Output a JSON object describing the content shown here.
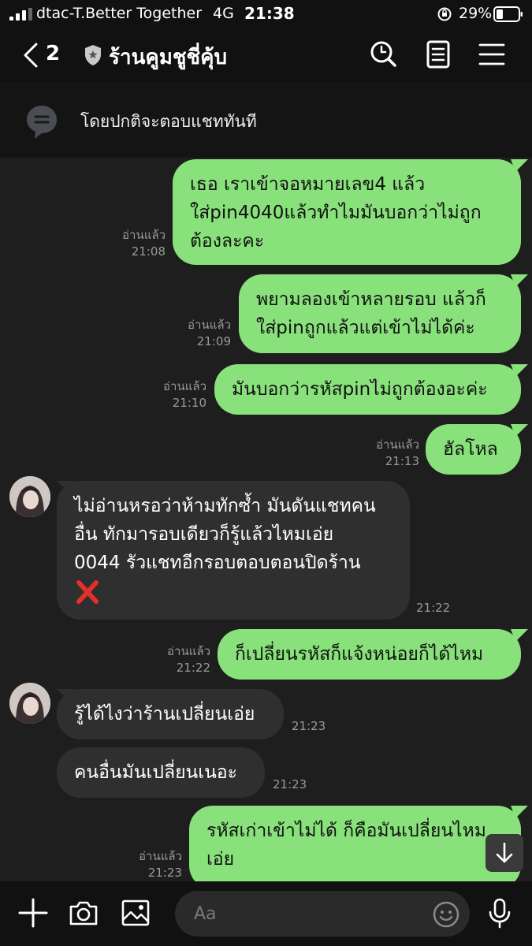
{
  "status_bar": {
    "carrier": "dtac-T.Better Together",
    "network": "4G",
    "time": "21:38",
    "battery": "29%"
  },
  "header": {
    "back_count": "2",
    "title": "ร้านคูมชูชี่คุ้บ",
    "icons": [
      "back-chevron-icon",
      "shield-star-icon",
      "search-icon",
      "note-icon",
      "menu-icon"
    ]
  },
  "notice": {
    "text": "โดยปกติจะตอบแชททันที",
    "icon": "chat-bubble-icon"
  },
  "messages": [
    {
      "direction": "out",
      "lines": [
        "เธอ เราเข้าจอหมายเลข4 แล้ว",
        "ใส่pin4040แล้วทำไมมันบอกว่าไม่ถูก",
        "ต้องละคะ"
      ],
      "read": "อ่านแล้ว",
      "time": "21:08"
    },
    {
      "direction": "out",
      "lines": [
        "พยามลองเข้าหลายรอบ แล้วก็",
        "ใส่pinถูกแล้วแต่เข้าไม่ได้ค่ะ"
      ],
      "read": "อ่านแล้ว",
      "time": "21:09"
    },
    {
      "direction": "out",
      "lines": [
        "มันบอกว่ารหัสpinไม่ถูกต้องอะค่ะ"
      ],
      "read": "อ่านแล้ว",
      "time": "21:10"
    },
    {
      "direction": "out",
      "lines": [
        "ฮัลโหล"
      ],
      "read": "อ่านแล้ว",
      "time": "21:13"
    },
    {
      "direction": "in",
      "lines": [
        "ไม่อ่านหรอว่าห้ามทักซ้ำ มันดันแชทคน",
        "อื่น ทักมารอบเดียวก็รู้แล้วไหมเอ่ย",
        "0044 รัวแชทอีกรอบตอบตอนปิดร้าน"
      ],
      "trailing_icon": "red-x-icon",
      "time": "21:22"
    },
    {
      "direction": "out",
      "lines": [
        "ก็เปลี่ยนรหัสก็แจ้งหน่อยก็ได้ไหม"
      ],
      "read": "อ่านแล้ว",
      "time": "21:22"
    },
    {
      "direction": "in",
      "lines": [
        "รู้ได้ไงว่าร้านเปลี่ยนเอ่ย"
      ],
      "time": "21:23"
    },
    {
      "direction": "in",
      "lines": [
        "คนอื่นมันเปลี่ยนเนอะ"
      ],
      "time": "21:23"
    },
    {
      "direction": "out",
      "lines": [
        "รหัสเก่าเข้าไม่ได้ ก็คือมันเปลี่ยนไหม",
        "เอ่ย"
      ],
      "read": "อ่านแล้ว",
      "time": "21:23"
    }
  ],
  "input_bar": {
    "placeholder": "Aa",
    "icons": [
      "plus-icon",
      "camera-icon",
      "image-icon",
      "emoji-icon",
      "microphone-icon"
    ]
  },
  "colors": {
    "outgoing_bubble": "#88e17a",
    "incoming_bubble": "#2f2f2f",
    "chat_background": "#1e1e1e",
    "bar_background": "#111111",
    "x_mark": "#e0312a"
  }
}
